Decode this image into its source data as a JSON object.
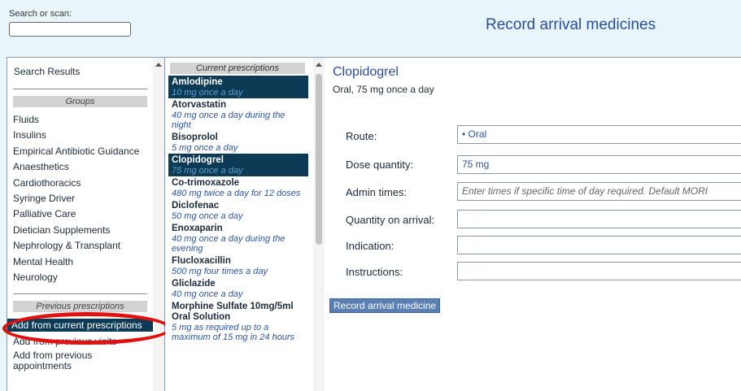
{
  "search": {
    "label": "Search or scan:",
    "value": ""
  },
  "page_title": "Record arrival medicines",
  "left_panel": {
    "search_results_label": "Search Results",
    "groups_header": "Groups",
    "groups": [
      "Fluids",
      "Insulins",
      "Empirical Antibiotic Guidance",
      "Anaesthetics",
      "Cardiothoracics",
      "Syringe Driver",
      "Palliative Care",
      "Dietician Supplements",
      "Nephrology & Transplant",
      "Mental Health",
      "Neurology"
    ],
    "previous_header": "Previous prescriptions",
    "add_current": "Add from current prescriptions",
    "add_previous_visits": "Add from previous visits",
    "add_previous_appointments": "Add from previous appointments"
  },
  "prescriptions": {
    "header": "Current prescriptions",
    "items": [
      {
        "name": "Amlodipine",
        "dose": "10 mg once a day",
        "selected": true
      },
      {
        "name": "Atorvastatin",
        "dose": "40 mg once a day during the night",
        "selected": false
      },
      {
        "name": "Bisoprolol",
        "dose": "5 mg once a day",
        "selected": false
      },
      {
        "name": "Clopidogrel",
        "dose": "75 mg once a day",
        "selected": true
      },
      {
        "name": "Co-trimoxazole",
        "dose": "480 mg twice a day for 12 doses",
        "selected": false
      },
      {
        "name": "Diclofenac",
        "dose": "50 mg once a day",
        "selected": false
      },
      {
        "name": "Enoxaparin",
        "dose": "40 mg once a day during the evening",
        "selected": false
      },
      {
        "name": "Flucloxacillin",
        "dose": "500 mg four times a day",
        "selected": false
      },
      {
        "name": "Gliclazide",
        "dose": "40 mg once a day",
        "selected": false
      },
      {
        "name": "Morphine Sulfate 10mg/5ml Oral Solution",
        "dose": "5 mg as required up to a maximum of 15 mg in 24 hours",
        "selected": false
      }
    ]
  },
  "detail": {
    "drug_name": "Clopidogrel",
    "drug_summary": "Oral, 75 mg once a day",
    "route_label": "Route:",
    "route_value": "• Oral",
    "dose_label": "Dose quantity:",
    "dose_value": "75 mg",
    "admin_label": "Admin times:",
    "admin_placeholder": "Enter times if specific time of day required. Default MORI",
    "quantity_label": "Quantity on arrival:",
    "quantity_value": "",
    "indication_label": "Indication:",
    "indication_value": "",
    "instructions_label": "Instructions:",
    "instructions_value": "",
    "record_button": "Record arrival medicine"
  },
  "colors": {
    "background": "#e8f6fc",
    "selected": "#0d3a55",
    "title": "#2a4d9c",
    "annotation": "#e0120f"
  }
}
